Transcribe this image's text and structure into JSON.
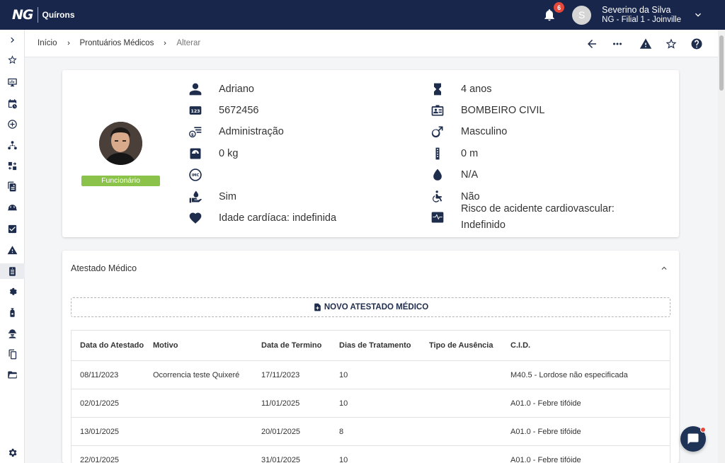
{
  "app": {
    "logo_mark": "NG",
    "logo_name": "Quírons"
  },
  "topbar": {
    "notification_count": "6",
    "avatar_letter": "S",
    "user_name": "Severino da Silva",
    "user_branch": "NG - Filial 1 - Joinville"
  },
  "breadcrumb": [
    "Início",
    "Prontuários Médicos",
    "Alterar"
  ],
  "patient": {
    "role_badge": "Funcionário",
    "left_fields": [
      {
        "icon": "person-icon",
        "value": "Adriano"
      },
      {
        "icon": "number-123-icon",
        "value": "5672456"
      },
      {
        "icon": "money-department-icon",
        "value": "Administração"
      },
      {
        "icon": "weight-scale-icon",
        "value": "0 kg"
      },
      {
        "icon": "imc-icon",
        "value": ""
      },
      {
        "icon": "hand-drop-icon",
        "value": "Sim"
      },
      {
        "icon": "heart-icon",
        "value": "Idade cardíaca: indefinida"
      }
    ],
    "right_fields": [
      {
        "icon": "hourglass-icon",
        "value": "4 anos"
      },
      {
        "icon": "id-badge-icon",
        "value": "BOMBEIRO CIVIL"
      },
      {
        "icon": "male-icon",
        "value": "Masculino"
      },
      {
        "icon": "ruler-icon",
        "value": "0 m"
      },
      {
        "icon": "blood-drop-icon",
        "value": "N/A"
      },
      {
        "icon": "wheelchair-icon",
        "value": "Não"
      },
      {
        "icon": "heartbeat-monitor-icon",
        "value": "Risco de acidente cardiovascular: Indefinido"
      }
    ]
  },
  "atestado": {
    "title": "Atestado Médico",
    "new_button": "NOVO ATESTADO MÉDICO",
    "columns": [
      "Data do Atestado",
      "Motivo",
      "Data de Termino",
      "Dias de Tratamento",
      "Tipo de Ausência",
      "C.I.D."
    ],
    "rows": [
      [
        "08/11/2023",
        "Ocorrencia teste Quixeré",
        "17/11/2023",
        "10",
        "",
        "M40.5 - Lordose não especificada"
      ],
      [
        "02/01/2025",
        "",
        "11/01/2025",
        "10",
        "",
        "A01.0 - Febre tifóide"
      ],
      [
        "13/01/2025",
        "",
        "20/01/2025",
        "8",
        "",
        "A01.0 - Febre tifóide"
      ],
      [
        "22/01/2025",
        "",
        "31/01/2025",
        "10",
        "",
        "A01.0 - Febre tifóide"
      ]
    ]
  },
  "colors": {
    "navy": "#17264a",
    "badge_green": "#8bc34a",
    "notification_red": "#e5483b"
  }
}
